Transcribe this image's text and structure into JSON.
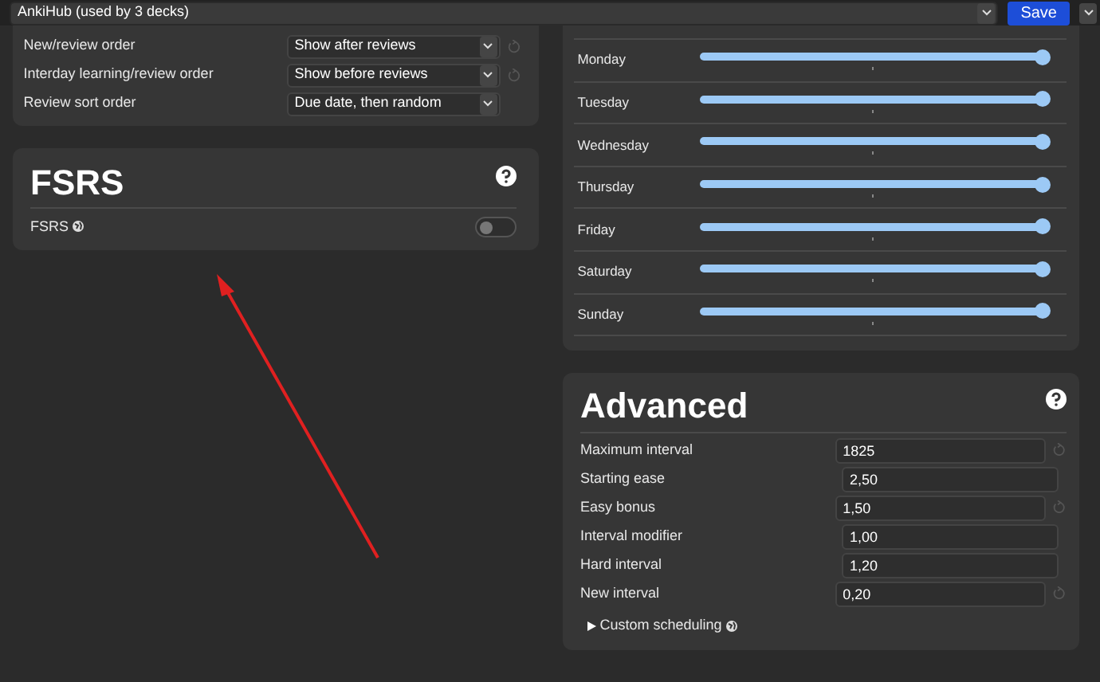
{
  "header": {
    "deck": "AnkiHub (used by 3 decks)",
    "save": "Save"
  },
  "display_order": {
    "rows": [
      {
        "label": "New/review order",
        "value": "Show after reviews",
        "reset": true
      },
      {
        "label": "Interday learning/review order",
        "value": "Show before reviews",
        "reset": true
      },
      {
        "label": "Review sort order",
        "value": "Due date, then random",
        "reset": false
      }
    ]
  },
  "fsrs": {
    "title": "FSRS",
    "toggle": {
      "label": "FSRS",
      "on": false
    }
  },
  "easy_days": {
    "rows": [
      {
        "label": "Monday",
        "level": 1.0
      },
      {
        "label": "Tuesday",
        "level": 1.0
      },
      {
        "label": "Wednesday",
        "level": 1.0
      },
      {
        "label": "Thursday",
        "level": 1.0
      },
      {
        "label": "Friday",
        "level": 1.0
      },
      {
        "label": "Saturday",
        "level": 1.0
      },
      {
        "label": "Sunday",
        "level": 1.0
      }
    ]
  },
  "advanced": {
    "title": "Advanced",
    "rows": [
      {
        "label": "Maximum interval",
        "value": "1825",
        "reset": true
      },
      {
        "label": "Starting ease",
        "value": "2,50",
        "reset": false
      },
      {
        "label": "Easy bonus",
        "value": "1,50",
        "reset": true
      },
      {
        "label": "Interval modifier",
        "value": "1,00",
        "reset": false
      },
      {
        "label": "Hard interval",
        "value": "1,20",
        "reset": false
      },
      {
        "label": "New interval",
        "value": "0,20",
        "reset": true
      }
    ],
    "custom_scheduling": {
      "label": "Custom scheduling",
      "expanded": false
    }
  }
}
